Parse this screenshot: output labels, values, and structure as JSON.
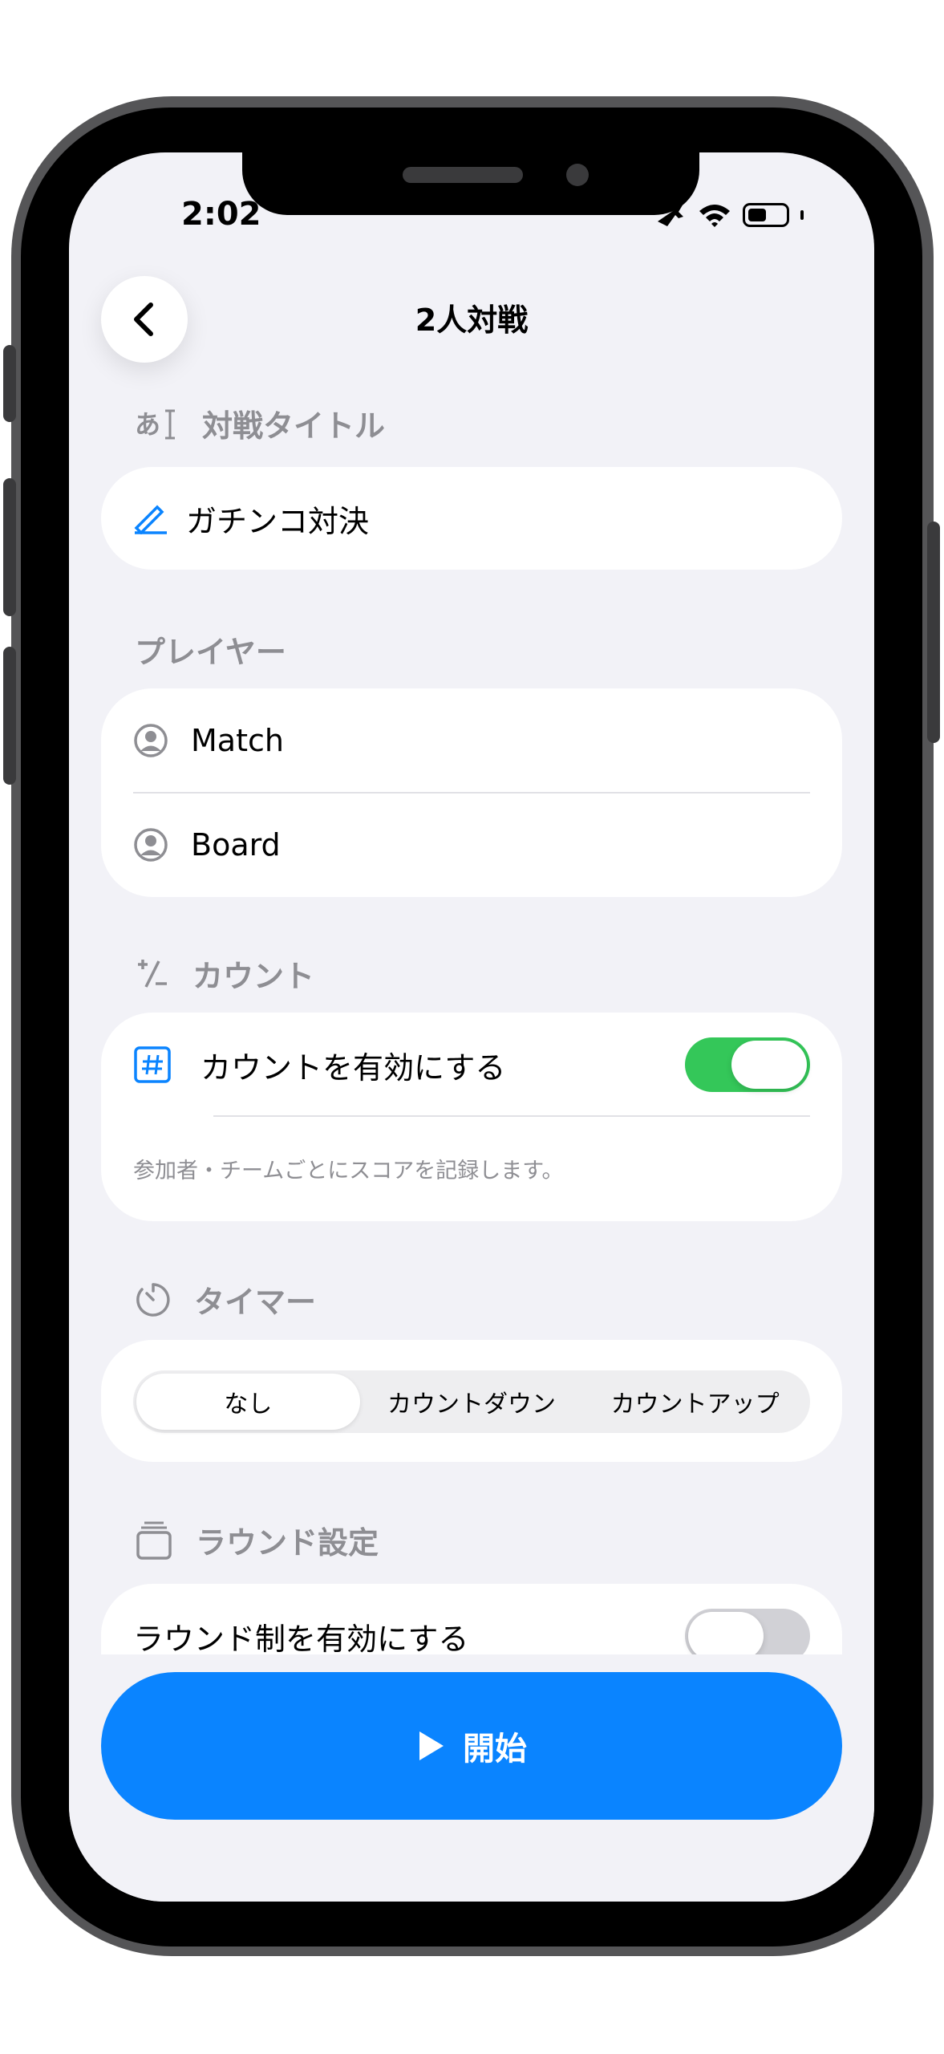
{
  "status": {
    "time": "2:02"
  },
  "nav": {
    "title": "2人対戦"
  },
  "title_section": {
    "label": "対戦タイトル",
    "value": "ガチンコ対決"
  },
  "players_section": {
    "label": "プレイヤー",
    "players": [
      "Match",
      "Board"
    ]
  },
  "count_section": {
    "label": "カウント",
    "toggle_label": "カウントを有効にする",
    "toggle_on": true,
    "description": "参加者・チームごとにスコアを記録します。"
  },
  "timer_section": {
    "label": "タイマー",
    "options": [
      "なし",
      "カウントダウン",
      "カウントアップ"
    ],
    "selected": "なし"
  },
  "round_section": {
    "label": "ラウンド設定",
    "toggle_label": "ラウンド制を有効にする",
    "toggle_on": false
  },
  "start_button": {
    "label": "開始"
  },
  "colors": {
    "accent": "#0a84ff",
    "toggle_on": "#34c759",
    "toggle_off": "#d1d1d6",
    "section_label": "#8e8e93"
  }
}
